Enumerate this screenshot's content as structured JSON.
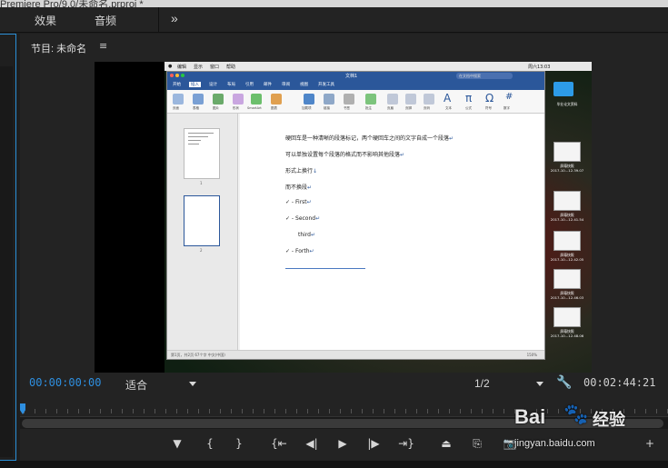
{
  "window": {
    "title": "Premiere Pro/9.0/未命名.prproj *"
  },
  "tabs": [
    {
      "label": "效果"
    },
    {
      "label": "音频"
    }
  ],
  "tabs_more": "»",
  "panel": {
    "title": "节目: 未命名",
    "menu": "≡"
  },
  "screen": {
    "mac_menu": [
      "",
      "编辑",
      "显示",
      "窗口",
      "帮助"
    ],
    "mac_status": "周六13:03",
    "word_title": "文档1",
    "word_search_placeholder": "在文档中搜索",
    "ribbon_tabs": [
      "开始",
      "插入",
      "设计",
      "布局",
      "引用",
      "邮件",
      "审阅",
      "视图",
      "开发工具"
    ],
    "ribbon_groups": [
      "页面",
      "表格",
      "图片",
      "形状",
      "SmartArt",
      "图表",
      "加载项",
      "链接",
      "书签",
      "批注",
      "页眉",
      "页脚",
      "页码",
      "文本",
      "公式",
      "符号",
      "数字"
    ],
    "doc_lines": [
      {
        "text": "硬回车是一种清晰的段落标记，两个硬回车之间的文字自成一个段落",
        "mark": "↵"
      },
      {
        "text": "可以单独设置每个段落的格式而不影响其他段落",
        "mark": "↵"
      },
      {
        "text": "形式上换行",
        "mark": "↓"
      },
      {
        "text": "而不换段",
        "mark": "↵"
      },
      {
        "text": "✓ - First",
        "mark": "↵"
      },
      {
        "text": "✓ - Second",
        "mark": "↵"
      },
      {
        "text": "third",
        "mark": "↵"
      },
      {
        "text": "✓ - Forth",
        "mark": "↵"
      }
    ],
    "page_thumbs": [
      "1",
      "2"
    ],
    "status_left": "第1页，共2页   67个字   中文(中国)",
    "status_zoom": "150%",
    "desktop_folder": "毕业论文资料",
    "desktop_shots": [
      {
        "name": "屏幕快照",
        "date": "2017-10...12.39.07"
      },
      {
        "name": "屏幕快照",
        "date": "2017-10...12.41.54"
      },
      {
        "name": "屏幕快照",
        "date": "2017-10...12.42.05"
      },
      {
        "name": "屏幕快照",
        "date": "2017-10...12.46.03"
      },
      {
        "name": "屏幕快照",
        "date": "2017-10...12.48.06"
      }
    ]
  },
  "controls": {
    "timecode_left": "00:00:00:00",
    "fit_label": "适合",
    "resolution_label": "1/2",
    "timecode_right": "00:02:44:21"
  },
  "transport": [
    {
      "name": "add-marker-button",
      "glyph": "▼"
    },
    {
      "name": "mark-in-button",
      "glyph": "{"
    },
    {
      "name": "mark-out-button",
      "glyph": "}"
    },
    {
      "name": "go-to-in-button",
      "glyph": "{⇤"
    },
    {
      "name": "step-back-button",
      "glyph": "◀|"
    },
    {
      "name": "play-button",
      "glyph": "▶"
    },
    {
      "name": "step-forward-button",
      "glyph": "|▶"
    },
    {
      "name": "go-to-out-button",
      "glyph": "⇥}"
    },
    {
      "name": "lift-button",
      "glyph": "⏏"
    },
    {
      "name": "extract-button",
      "glyph": "⎘"
    },
    {
      "name": "export-frame-button",
      "glyph": "📷"
    },
    {
      "name": "add-button",
      "glyph": "+"
    }
  ],
  "watermark": {
    "logo": "Bai  ",
    "cn": "经验",
    "url": "jingyan.baidu.com"
  },
  "colors": {
    "accent": "#2e8fe0",
    "word_blue": "#2b579a",
    "panel_bg": "#232323"
  }
}
